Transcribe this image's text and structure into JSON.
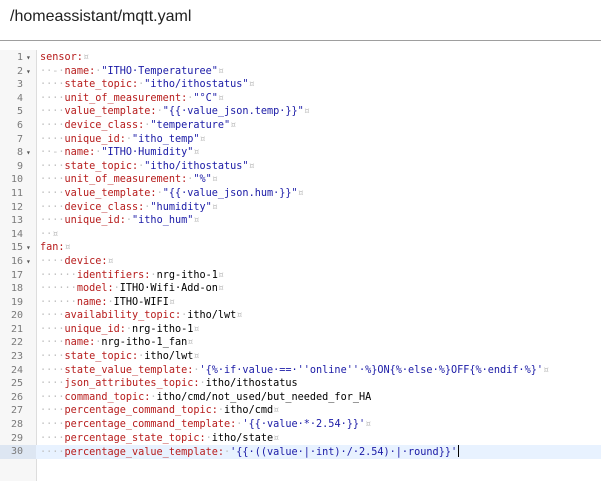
{
  "header": {
    "file_path": "/homeassistant/mqtt.yaml"
  },
  "editor": {
    "lines": [
      {
        "n": "1",
        "fold": "▾",
        "tokens": [
          [
            "key",
            "sensor:"
          ],
          [
            "ws",
            "¤"
          ]
        ]
      },
      {
        "n": "2",
        "fold": "▾",
        "tokens": [
          [
            "ws",
            "··-·"
          ],
          [
            "key",
            "name:"
          ],
          [
            "ws",
            "·"
          ],
          [
            "str",
            "\"ITHO·Temperaturee\""
          ],
          [
            "ws",
            "¤"
          ]
        ]
      },
      {
        "n": "3",
        "fold": "",
        "tokens": [
          [
            "ws",
            "····"
          ],
          [
            "key",
            "state_topic:"
          ],
          [
            "ws",
            "·"
          ],
          [
            "str",
            "\"itho/ithostatus\""
          ],
          [
            "ws",
            "¤"
          ]
        ]
      },
      {
        "n": "4",
        "fold": "",
        "tokens": [
          [
            "ws",
            "····"
          ],
          [
            "key",
            "unit_of_measurement:"
          ],
          [
            "ws",
            "·"
          ],
          [
            "str",
            "\"°C\""
          ],
          [
            "ws",
            "¤"
          ]
        ]
      },
      {
        "n": "5",
        "fold": "",
        "tokens": [
          [
            "ws",
            "····"
          ],
          [
            "key",
            "value_template:"
          ],
          [
            "ws",
            "·"
          ],
          [
            "str",
            "\"{{·value_json.temp·}}\""
          ],
          [
            "ws",
            "¤"
          ]
        ]
      },
      {
        "n": "6",
        "fold": "",
        "tokens": [
          [
            "ws",
            "····"
          ],
          [
            "key",
            "device_class:"
          ],
          [
            "ws",
            "·"
          ],
          [
            "str",
            "\"temperature\""
          ],
          [
            "ws",
            "¤"
          ]
        ]
      },
      {
        "n": "7",
        "fold": "",
        "tokens": [
          [
            "ws",
            "····"
          ],
          [
            "key",
            "unique_id:"
          ],
          [
            "ws",
            "·"
          ],
          [
            "str",
            "\"itho_temp\""
          ],
          [
            "ws",
            "¤"
          ]
        ]
      },
      {
        "n": "8",
        "fold": "▾",
        "tokens": [
          [
            "ws",
            "··-·"
          ],
          [
            "key",
            "name:"
          ],
          [
            "ws",
            "·"
          ],
          [
            "str",
            "\"ITHO·Humidity\""
          ],
          [
            "ws",
            "¤"
          ]
        ]
      },
      {
        "n": "9",
        "fold": "",
        "tokens": [
          [
            "ws",
            "····"
          ],
          [
            "key",
            "state_topic:"
          ],
          [
            "ws",
            "·"
          ],
          [
            "str",
            "\"itho/ithostatus\""
          ],
          [
            "ws",
            "¤"
          ]
        ]
      },
      {
        "n": "10",
        "fold": "",
        "tokens": [
          [
            "ws",
            "····"
          ],
          [
            "key",
            "unit_of_measurement:"
          ],
          [
            "ws",
            "·"
          ],
          [
            "str",
            "\"%\""
          ],
          [
            "ws",
            "¤"
          ]
        ]
      },
      {
        "n": "11",
        "fold": "",
        "tokens": [
          [
            "ws",
            "····"
          ],
          [
            "key",
            "value_template:"
          ],
          [
            "ws",
            "·"
          ],
          [
            "str",
            "\"{{·value_json.hum·}}\""
          ],
          [
            "ws",
            "¤"
          ]
        ]
      },
      {
        "n": "12",
        "fold": "",
        "tokens": [
          [
            "ws",
            "····"
          ],
          [
            "key",
            "device_class:"
          ],
          [
            "ws",
            "·"
          ],
          [
            "str",
            "\"humidity\""
          ],
          [
            "ws",
            "¤"
          ]
        ]
      },
      {
        "n": "13",
        "fold": "",
        "tokens": [
          [
            "ws",
            "····"
          ],
          [
            "key",
            "unique_id:"
          ],
          [
            "ws",
            "·"
          ],
          [
            "str",
            "\"itho_hum\""
          ],
          [
            "ws",
            "¤"
          ]
        ]
      },
      {
        "n": "14",
        "fold": "",
        "tokens": [
          [
            "ws",
            "··¤"
          ]
        ]
      },
      {
        "n": "15",
        "fold": "▾",
        "tokens": [
          [
            "key",
            "fan:"
          ],
          [
            "ws",
            "¤"
          ]
        ]
      },
      {
        "n": "16",
        "fold": "▾",
        "tokens": [
          [
            "ws",
            "····"
          ],
          [
            "key",
            "device:"
          ],
          [
            "ws",
            "¤"
          ]
        ]
      },
      {
        "n": "17",
        "fold": "",
        "tokens": [
          [
            "ws",
            "······"
          ],
          [
            "key",
            "identifiers:"
          ],
          [
            "ws",
            "·"
          ],
          [
            "plain",
            "nrg-itho-1"
          ],
          [
            "ws",
            "¤"
          ]
        ]
      },
      {
        "n": "18",
        "fold": "",
        "tokens": [
          [
            "ws",
            "······"
          ],
          [
            "key",
            "model:"
          ],
          [
            "ws",
            "·"
          ],
          [
            "plain",
            "ITHO·Wifi·Add-on"
          ],
          [
            "ws",
            "¤"
          ]
        ]
      },
      {
        "n": "19",
        "fold": "",
        "tokens": [
          [
            "ws",
            "······"
          ],
          [
            "key",
            "name:"
          ],
          [
            "ws",
            "·"
          ],
          [
            "plain",
            "ITHO-WIFI"
          ],
          [
            "ws",
            "¤"
          ]
        ]
      },
      {
        "n": "20",
        "fold": "",
        "tokens": [
          [
            "ws",
            "····"
          ],
          [
            "key",
            "availability_topic:"
          ],
          [
            "ws",
            "·"
          ],
          [
            "plain",
            "itho/lwt"
          ],
          [
            "ws",
            "¤"
          ]
        ]
      },
      {
        "n": "21",
        "fold": "",
        "tokens": [
          [
            "ws",
            "····"
          ],
          [
            "key",
            "unique_id:"
          ],
          [
            "ws",
            "·"
          ],
          [
            "plain",
            "nrg-itho-1"
          ],
          [
            "ws",
            "¤"
          ]
        ]
      },
      {
        "n": "22",
        "fold": "",
        "tokens": [
          [
            "ws",
            "····"
          ],
          [
            "key",
            "name:"
          ],
          [
            "ws",
            "·"
          ],
          [
            "plain",
            "nrg-itho-1_fan"
          ],
          [
            "ws",
            "¤"
          ]
        ]
      },
      {
        "n": "23",
        "fold": "",
        "tokens": [
          [
            "ws",
            "····"
          ],
          [
            "key",
            "state_topic:"
          ],
          [
            "ws",
            "·"
          ],
          [
            "plain",
            "itho/lwt"
          ],
          [
            "ws",
            "¤"
          ]
        ]
      },
      {
        "n": "24",
        "fold": "",
        "tokens": [
          [
            "ws",
            "····"
          ],
          [
            "key",
            "state_value_template:"
          ],
          [
            "ws",
            "·"
          ],
          [
            "str",
            "'{%·if·value·==·''online''·%}ON{%·else·%}OFF{%·endif·%}'"
          ],
          [
            "ws",
            "¤"
          ]
        ]
      },
      {
        "n": "25",
        "fold": "",
        "tokens": [
          [
            "ws",
            "····"
          ],
          [
            "key",
            "json_attributes_topic:"
          ],
          [
            "ws",
            "·"
          ],
          [
            "plain",
            "itho/ithostatus"
          ]
        ]
      },
      {
        "n": "26",
        "fold": "",
        "tokens": [
          [
            "ws",
            "····"
          ],
          [
            "key",
            "command_topic:"
          ],
          [
            "ws",
            "·"
          ],
          [
            "plain",
            "itho/cmd/not_used/but_needed_for_HA"
          ]
        ]
      },
      {
        "n": "27",
        "fold": "",
        "tokens": [
          [
            "ws",
            "····"
          ],
          [
            "key",
            "percentage_command_topic:"
          ],
          [
            "ws",
            "·"
          ],
          [
            "plain",
            "itho/cmd"
          ],
          [
            "ws",
            "¤"
          ]
        ]
      },
      {
        "n": "28",
        "fold": "",
        "tokens": [
          [
            "ws",
            "····"
          ],
          [
            "key",
            "percentage_command_template:"
          ],
          [
            "ws",
            "·"
          ],
          [
            "str",
            "'{{·value·*·2.54·}}'"
          ],
          [
            "ws",
            "¤"
          ]
        ]
      },
      {
        "n": "29",
        "fold": "",
        "tokens": [
          [
            "ws",
            "····"
          ],
          [
            "key",
            "percentage_state_topic:"
          ],
          [
            "ws",
            "·"
          ],
          [
            "plain",
            "itho/state"
          ],
          [
            "ws",
            "¤"
          ]
        ]
      },
      {
        "n": "30",
        "fold": "",
        "active": true,
        "tokens": [
          [
            "ws",
            "····"
          ],
          [
            "key",
            "percentage_value_template:"
          ],
          [
            "ws",
            "·"
          ],
          [
            "str",
            "'{{·((value·|·int)·/·2.54)·|·round}}'"
          ]
        ]
      }
    ]
  }
}
